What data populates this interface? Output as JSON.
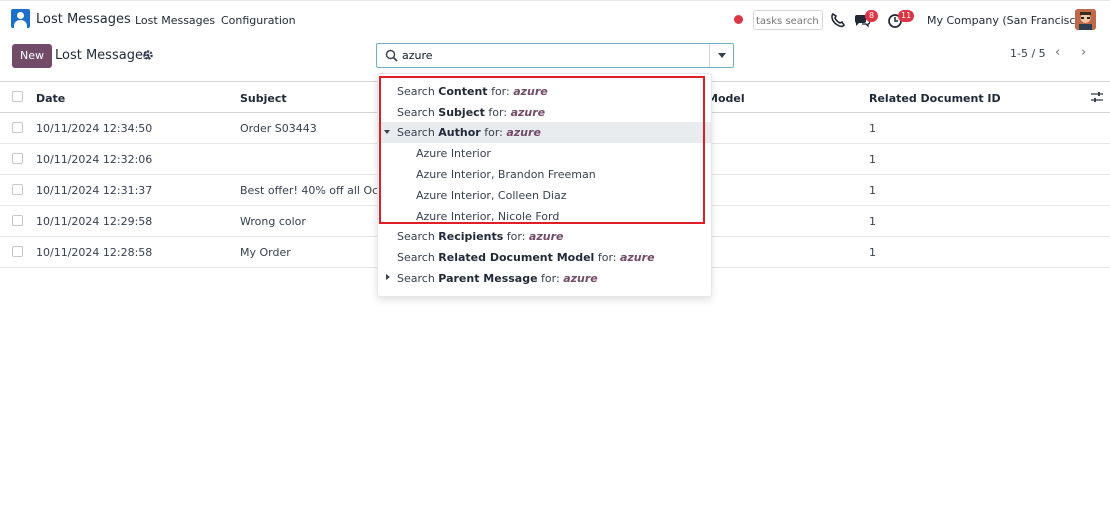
{
  "nav": {
    "app_title": "Lost Messages",
    "menu": [
      "Lost Messages",
      "Configuration"
    ],
    "tasks_search_placeholder": "tasks search",
    "messages_badge": "8",
    "activity_badge": "11",
    "company": "My Company (San Francisco)"
  },
  "control": {
    "new_label": "New",
    "title": "Lost Messages",
    "search_value": "azure",
    "pager": "1-5 / 5"
  },
  "table": {
    "headers": {
      "date": "Date",
      "subject": "Subject",
      "model": "Model",
      "related_id": "Related Document ID"
    },
    "rows": [
      {
        "date": "10/11/2024 12:34:50",
        "subject": "Order S03443",
        "related_id": "1"
      },
      {
        "date": "10/11/2024 12:32:06",
        "subject": "",
        "related_id": "1"
      },
      {
        "date": "10/11/2024 12:31:37",
        "subject": "Best offer! 40% off all Octobe",
        "related_id": "1"
      },
      {
        "date": "10/11/2024 12:29:58",
        "subject": "Wrong color",
        "related_id": "1"
      },
      {
        "date": "10/11/2024 12:28:58",
        "subject": "My Order",
        "related_id": "1"
      }
    ]
  },
  "dropdown": {
    "term": "azure",
    "items": [
      {
        "prefix": "Search ",
        "field": "Content",
        "mid": " for: "
      },
      {
        "prefix": "Search ",
        "field": "Subject",
        "mid": " for: "
      },
      {
        "prefix": "Search ",
        "field": "Author",
        "mid": " for: "
      },
      {
        "sub": "Azure Interior"
      },
      {
        "sub": "Azure Interior, Brandon Freeman"
      },
      {
        "sub": "Azure Interior, Colleen Diaz"
      },
      {
        "sub": "Azure Interior, Nicole Ford"
      },
      {
        "prefix": "Search ",
        "field": "Recipients",
        "mid": " for: "
      },
      {
        "prefix": "Search ",
        "field": "Related Document Model",
        "mid": " for: "
      },
      {
        "prefix": "Search ",
        "field": "Parent Message",
        "mid": " for: "
      }
    ]
  },
  "colors": {
    "brand": "#714b67",
    "app_icon": "#1d6fc9",
    "badge": "#dc3545",
    "highlight": "#e11d2a"
  }
}
